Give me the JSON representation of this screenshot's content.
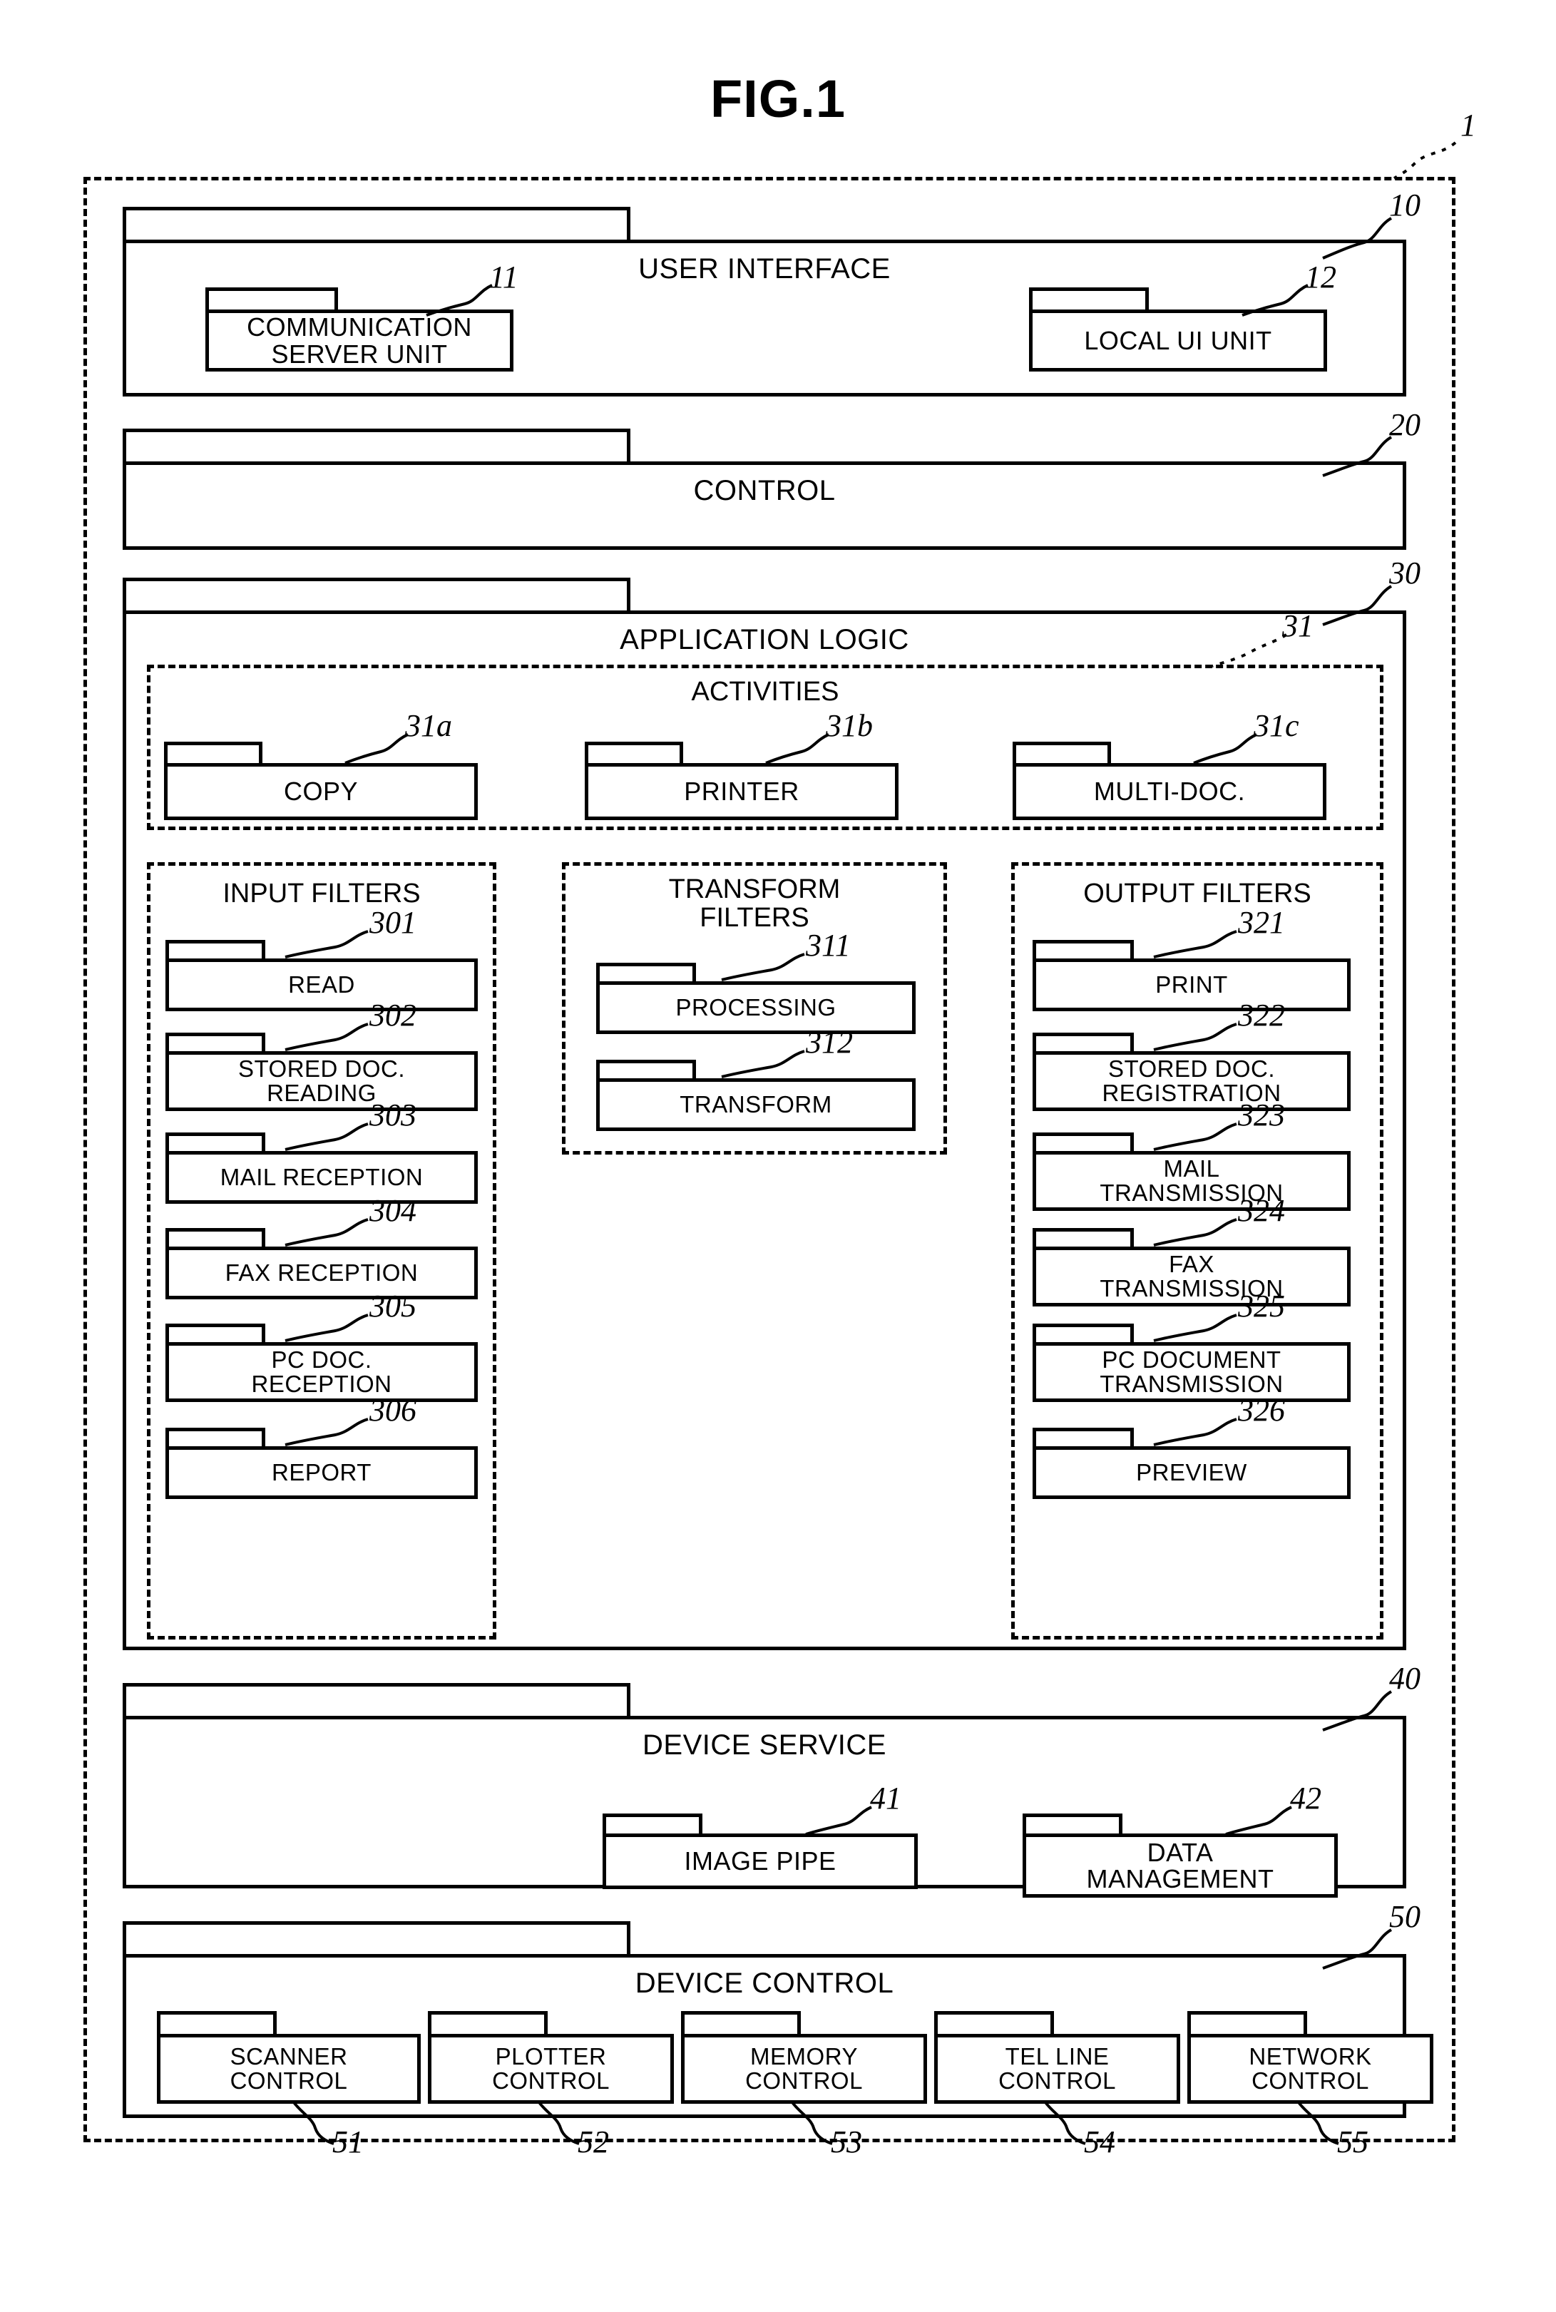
{
  "figure": {
    "title": "FIG.1",
    "system_ref": "1"
  },
  "layers": [
    {
      "ref": "10",
      "title": "USER INTERFACE",
      "children": [
        {
          "ref": "11",
          "label": "COMMUNICATION\nSERVER UNIT"
        },
        {
          "ref": "12",
          "label": "LOCAL UI UNIT"
        }
      ]
    },
    {
      "ref": "20",
      "title": "CONTROL",
      "children": []
    },
    {
      "ref": "30",
      "title": "APPLICATION LOGIC",
      "groups": [
        {
          "ref": "31",
          "title": "ACTIVITIES",
          "children": [
            {
              "ref": "31a",
              "label": "COPY"
            },
            {
              "ref": "31b",
              "label": "PRINTER"
            },
            {
              "ref": "31c",
              "label": "MULTI-DOC."
            }
          ]
        },
        {
          "title": "INPUT FILTERS",
          "children": [
            {
              "ref": "301",
              "label": "READ"
            },
            {
              "ref": "302",
              "label": "STORED DOC.\nREADING"
            },
            {
              "ref": "303",
              "label": "MAIL RECEPTION"
            },
            {
              "ref": "304",
              "label": "FAX RECEPTION"
            },
            {
              "ref": "305",
              "label": "PC DOC.\nRECEPTION"
            },
            {
              "ref": "306",
              "label": "REPORT"
            }
          ]
        },
        {
          "title": "TRANSFORM\nFILTERS",
          "children": [
            {
              "ref": "311",
              "label": "PROCESSING"
            },
            {
              "ref": "312",
              "label": "TRANSFORM"
            }
          ]
        },
        {
          "title": "OUTPUT FILTERS",
          "children": [
            {
              "ref": "321",
              "label": "PRINT"
            },
            {
              "ref": "322",
              "label": "STORED DOC.\nREGISTRATION"
            },
            {
              "ref": "323",
              "label": "MAIL\nTRANSMISSION"
            },
            {
              "ref": "324",
              "label": "FAX\nTRANSMISSION"
            },
            {
              "ref": "325",
              "label": "PC DOCUMENT\nTRANSMISSION"
            },
            {
              "ref": "326",
              "label": "PREVIEW"
            }
          ]
        }
      ]
    },
    {
      "ref": "40",
      "title": "DEVICE SERVICE",
      "children": [
        {
          "ref": "41",
          "label": "IMAGE PIPE"
        },
        {
          "ref": "42",
          "label": "DATA\nMANAGEMENT"
        }
      ]
    },
    {
      "ref": "50",
      "title": "DEVICE CONTROL",
      "children": [
        {
          "ref": "51",
          "label": "SCANNER\nCONTROL"
        },
        {
          "ref": "52",
          "label": "PLOTTER\nCONTROL"
        },
        {
          "ref": "53",
          "label": "MEMORY\nCONTROL"
        },
        {
          "ref": "54",
          "label": "TEL LINE\nCONTROL"
        },
        {
          "ref": "55",
          "label": "NETWORK\nCONTROL"
        }
      ]
    }
  ],
  "colors": {
    "stroke": "#000000",
    "background": "#ffffff"
  }
}
